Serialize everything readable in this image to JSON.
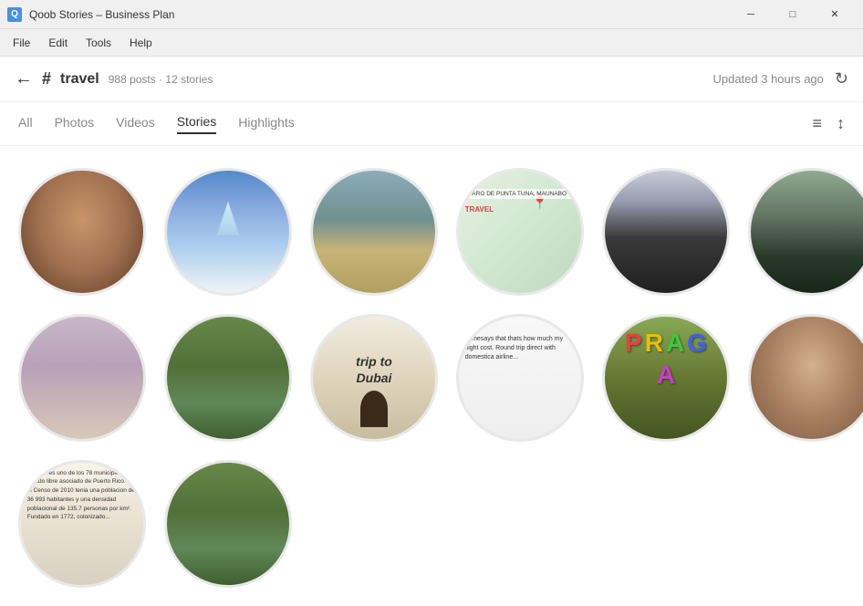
{
  "app": {
    "title": "Qoob Stories – Business Plan"
  },
  "titlebar": {
    "title": "Qoob Stories – Business Plan",
    "minimize_label": "─",
    "maximize_label": "□",
    "close_label": "✕"
  },
  "menubar": {
    "items": [
      "File",
      "Edit",
      "Tools",
      "Help"
    ]
  },
  "topnav": {
    "back_label": "←",
    "hashtag": "#",
    "channel": "travel",
    "meta": "988 posts · 12 stories",
    "updated": "Updated 3 hours ago",
    "refresh_icon": "↻"
  },
  "tabs": {
    "items": [
      {
        "label": "All",
        "active": false
      },
      {
        "label": "Photos",
        "active": false
      },
      {
        "label": "Videos",
        "active": false
      },
      {
        "label": "Stories",
        "active": true
      },
      {
        "label": "Highlights",
        "active": false
      }
    ],
    "filter_icon": "≡",
    "sort_icon": "↕"
  },
  "stories": {
    "items": [
      {
        "id": 1,
        "style": "story-face-1",
        "alt": "Woman face selfie"
      },
      {
        "id": 2,
        "style": "story-sky",
        "alt": "Sky and airplane wing"
      },
      {
        "id": 3,
        "style": "story-beach",
        "alt": "Beach with bags"
      },
      {
        "id": 4,
        "style": "story-map",
        "alt": "Map of travel location"
      },
      {
        "id": 5,
        "style": "story-man",
        "alt": "Man in leather jacket"
      },
      {
        "id": 6,
        "style": "story-car",
        "alt": "Car interior dashboard"
      },
      {
        "id": 7,
        "style": "story-girl",
        "alt": "Girl selfie"
      },
      {
        "id": 8,
        "style": "story-river",
        "alt": "River landscape"
      },
      {
        "id": 9,
        "style": "story-dubai",
        "alt": "Dubai trip text post"
      },
      {
        "id": 10,
        "style": "story-text",
        "alt": "Text about flight cost"
      },
      {
        "id": 11,
        "style": "story-colorful",
        "alt": "Colorful buildings"
      },
      {
        "id": 12,
        "style": "story-selfie",
        "alt": "Couple selfie"
      },
      {
        "id": 13,
        "style": "story-puertorico",
        "alt": "Puerto Rico text post"
      },
      {
        "id": 14,
        "style": "story-river",
        "alt": "Green river"
      }
    ]
  }
}
